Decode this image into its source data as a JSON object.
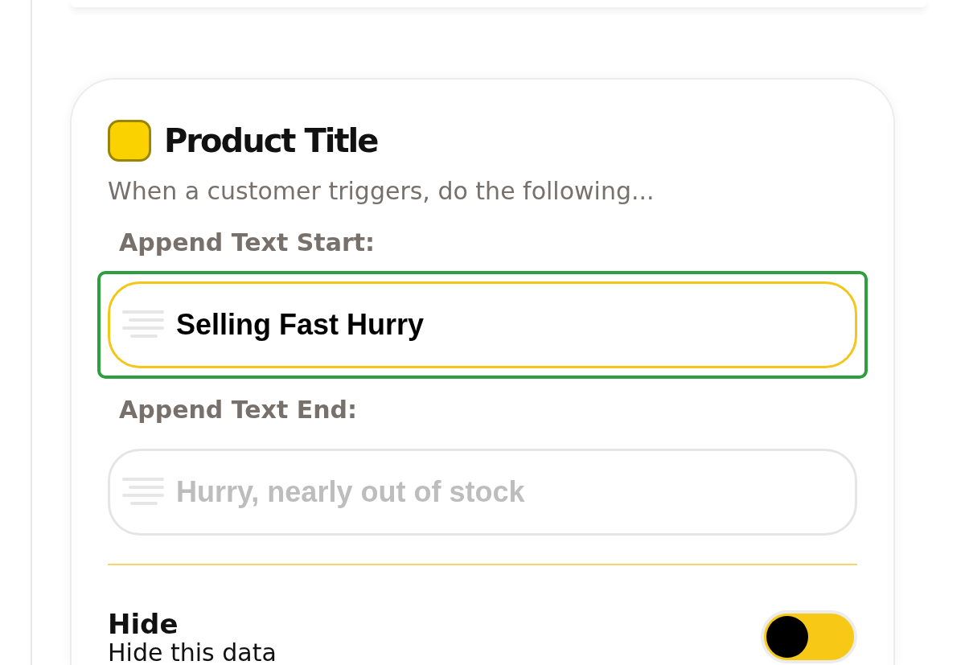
{
  "card": {
    "title": "Product Title",
    "subtitle": "When a customer triggers, do the following...",
    "fields": [
      {
        "label": "Append Text Start:",
        "value": "Selling Fast Hurry",
        "focused": true,
        "highlighted": true
      },
      {
        "label": "Append Text End:",
        "placeholder": "Hurry, nearly out of stock",
        "focused": false,
        "highlighted": false
      }
    ],
    "setting": {
      "title": "Hide",
      "description": "Hide this data",
      "on": false
    }
  }
}
